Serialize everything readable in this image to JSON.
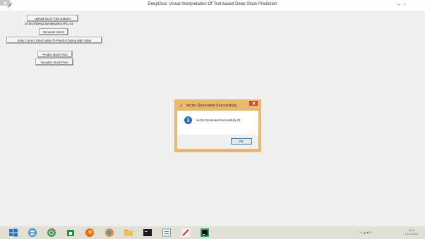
{
  "window": {
    "title": "DeepClue: Visual Interpretation Of Text-based Deep Stock Prediction",
    "controls": {
      "minimize": "–",
      "maximize": "▫"
    }
  },
  "main": {
    "upload_button": "Upload Stock Train Dataset",
    "file_path": "D:/2019/DeepClue/dataset/AAPL.csv",
    "generate_button": "Generate Vector",
    "enter_value_button": "Enter Current Stock Value To Predict Closing High Value",
    "predict_button": "Predict Stock Price",
    "visualize_button": "Visualize Stock Price"
  },
  "dialog": {
    "title": "Vector Generated Successfully",
    "message": "Vector Generated successfully 20",
    "ok_label": "OK",
    "icon": "info-icon"
  },
  "taskbar": {
    "items": [
      "windows-start-icon",
      "ie-icon",
      "chrome-icon",
      "store-icon",
      "firefox-icon",
      "media-icon",
      "folder-icon",
      "cmd-icon",
      "python-idle-icon",
      "snip-icon",
      "pycharm-icon"
    ],
    "clock_time": "15:12",
    "clock_date": "13-01-2020"
  },
  "colors": {
    "dialog_border": "#e9b96e",
    "info_icon": "#1f6fc4",
    "taskbar_bg": "#e2dfd4"
  }
}
